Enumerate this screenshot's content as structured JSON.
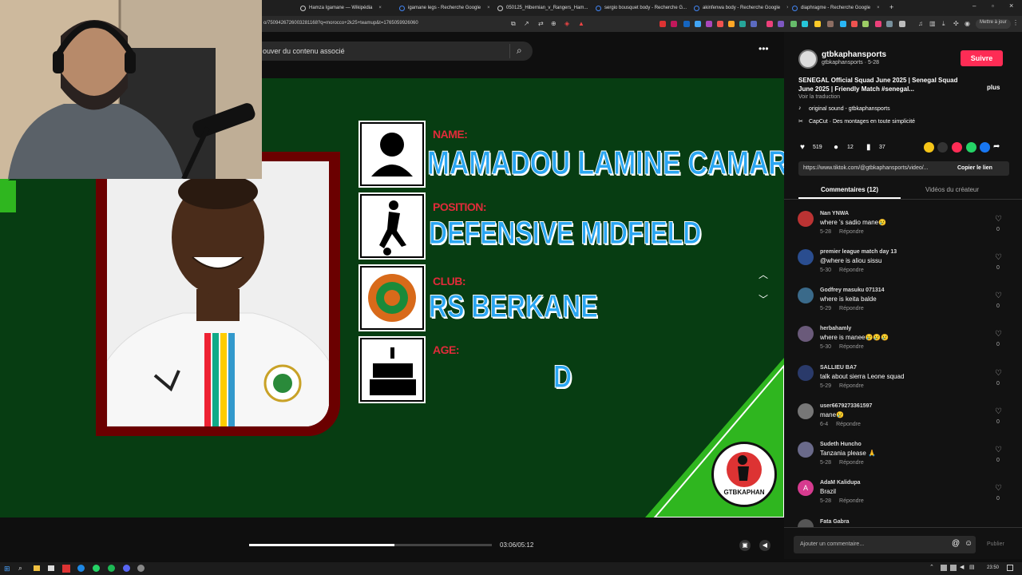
{
  "browser": {
    "tabs": [
      {
        "label": "Hamza Igamane — Wikipédia",
        "color": "#ffffff"
      },
      {
        "label": "igamane legs - Recherche Google",
        "color": "#4285f4"
      },
      {
        "label": "050125_Hibernian_v_Rangers_Ham...",
        "color": "#9aa0a6"
      },
      {
        "label": "sergio bousquet body - Recherche G...",
        "color": "#4285f4"
      },
      {
        "label": "akinfenwa body - Recherche Google",
        "color": "#4285f4"
      },
      {
        "label": "diaphragme - Recherche Google",
        "color": "#4285f4"
      }
    ],
    "new_tab": "+",
    "url": "o/7509426726003281168?q=morocco+2k25+teamup&t=1765059926060",
    "update_button": "Mettre à jour"
  },
  "search": {
    "placeholder": "ouver du contenu associé"
  },
  "graphic": {
    "name_label": "NAME:",
    "name_value": "MAMADOU LAMINE CAMARA",
    "position_label": "POSITION:",
    "position_value": "DEFENSIVE MIDFIELD",
    "club_label": "CLUB:",
    "club_value": "RS BERKANE",
    "age_label": "AGE:",
    "age_value": "D",
    "logo_text": "GTBKAPHAN"
  },
  "player": {
    "time": "03:06/05:12",
    "progress": 0.6
  },
  "sidebar": {
    "author_handle": "gtbkaphansports",
    "author_sub": "gtbkaphansports · 5-28",
    "follow": "Suivre",
    "description": "SENEGAL Official Squad June 2025 | Senegal Squad June 2025 | Friendly Match #senegal...",
    "more": "plus",
    "translate": "Voir la traduction",
    "sound": "original sound - gtbkaphansports",
    "capcut": "CapCut · Des montages en toute simplicité",
    "likes": "519",
    "comments_count": "12",
    "saves": "37",
    "link": "https://www.tiktok.com/@gtbkaphansports/video/...",
    "copy_link": "Copier le lien",
    "tab_comments": "Commentaires (12)",
    "tab_videos": "Vidéos du créateur",
    "comments": [
      {
        "name": "Nan YNWA",
        "text": "where 's sadio mane😢",
        "date": "5-28",
        "reply": "Répondre",
        "likes": "0",
        "avatar": "#b33"
      },
      {
        "name": "premier league match day 13",
        "text": "@where is aliou sissu",
        "date": "5-30",
        "reply": "Répondre",
        "likes": "0",
        "avatar": "#2a4d8f"
      },
      {
        "name": "Godfrey masuku 071314",
        "text": "where is keita balde",
        "date": "5-29",
        "reply": "Répondre",
        "likes": "0",
        "avatar": "#3a6a8a"
      },
      {
        "name": "herbahamly",
        "text": "where is manee😢😢😢",
        "date": "5-30",
        "reply": "Répondre",
        "likes": "0",
        "avatar": "#6a5a7a"
      },
      {
        "name": "SALLIEU BA7",
        "text": "talk about sierra Leone squad",
        "date": "5-29",
        "reply": "Répondre",
        "likes": "0",
        "avatar": "#2a3a6a"
      },
      {
        "name": "user6679273361597",
        "text": "mane😢",
        "date": "6-4",
        "reply": "Répondre",
        "likes": "0",
        "avatar": "#777"
      },
      {
        "name": "Sudeth Huncho",
        "text": "Tanzania please 🙏",
        "date": "5-28",
        "reply": "Répondre",
        "likes": "0",
        "avatar": "#6a6a8a"
      },
      {
        "name": "AdaM Kalidupa",
        "text": "Brazil",
        "date": "5-28",
        "reply": "Répondre",
        "likes": "0",
        "avatar": "#d63b8f",
        "initial": "A"
      },
      {
        "name": "Fata Gabra",
        "text": "",
        "date": "",
        "reply": "",
        "likes": "",
        "avatar": "#555"
      }
    ],
    "comment_placeholder": "Ajouter un commentaire...",
    "publish": "Publier"
  },
  "taskbar": {
    "time": "23:50"
  },
  "colors": {
    "follow": "#fe2c55",
    "stage_green": "#073d12",
    "stripe_green": "#2fb61f",
    "label_red": "#e12b3a",
    "value_blue": "#2aa6f2"
  }
}
